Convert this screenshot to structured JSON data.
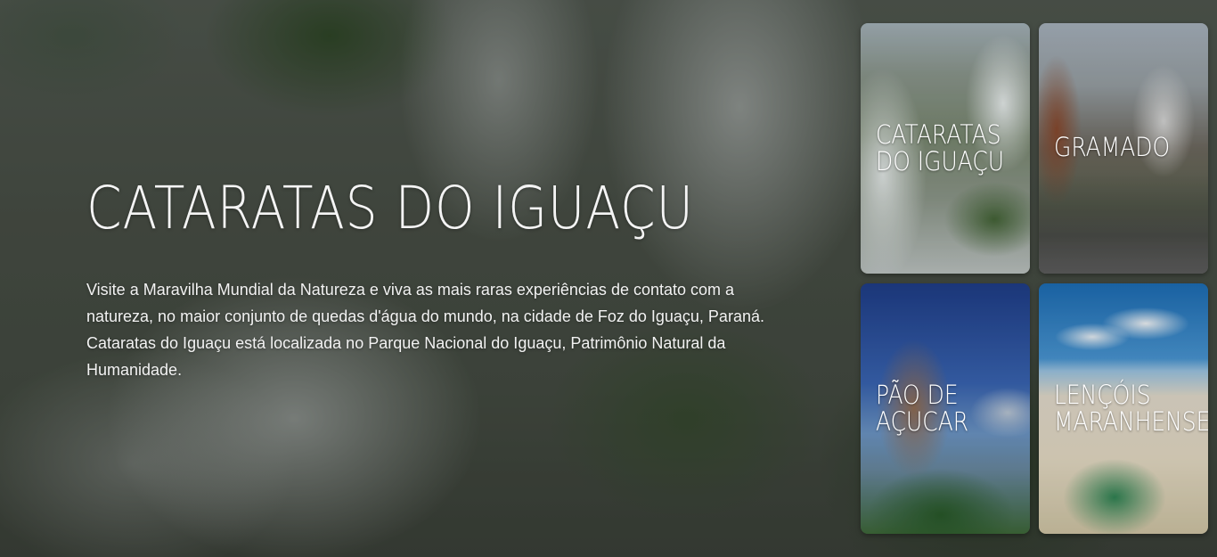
{
  "hero": {
    "title": "CATARATAS DO IGUAÇU",
    "description": "Visite a Maravilha Mundial da Natureza e viva as mais raras experiências de contato com a natureza, no maior conjunto de quedas d'água do mundo, na cidade de Foz do Iguaçu, Paraná. Cataratas do Iguaçu está localizada no Parque Nacional do Iguaçu, Patrimônio Natural da Humanidade."
  },
  "destinations": [
    {
      "line1": "CATARATAS",
      "line2": "DO IGUAÇU"
    },
    {
      "line1": "GRAMADO",
      "line2": ""
    },
    {
      "line1": "PÃO DE",
      "line2": "AÇUCAR"
    },
    {
      "line1": "LENÇÓIS",
      "line2": "MARANHENSES"
    }
  ]
}
